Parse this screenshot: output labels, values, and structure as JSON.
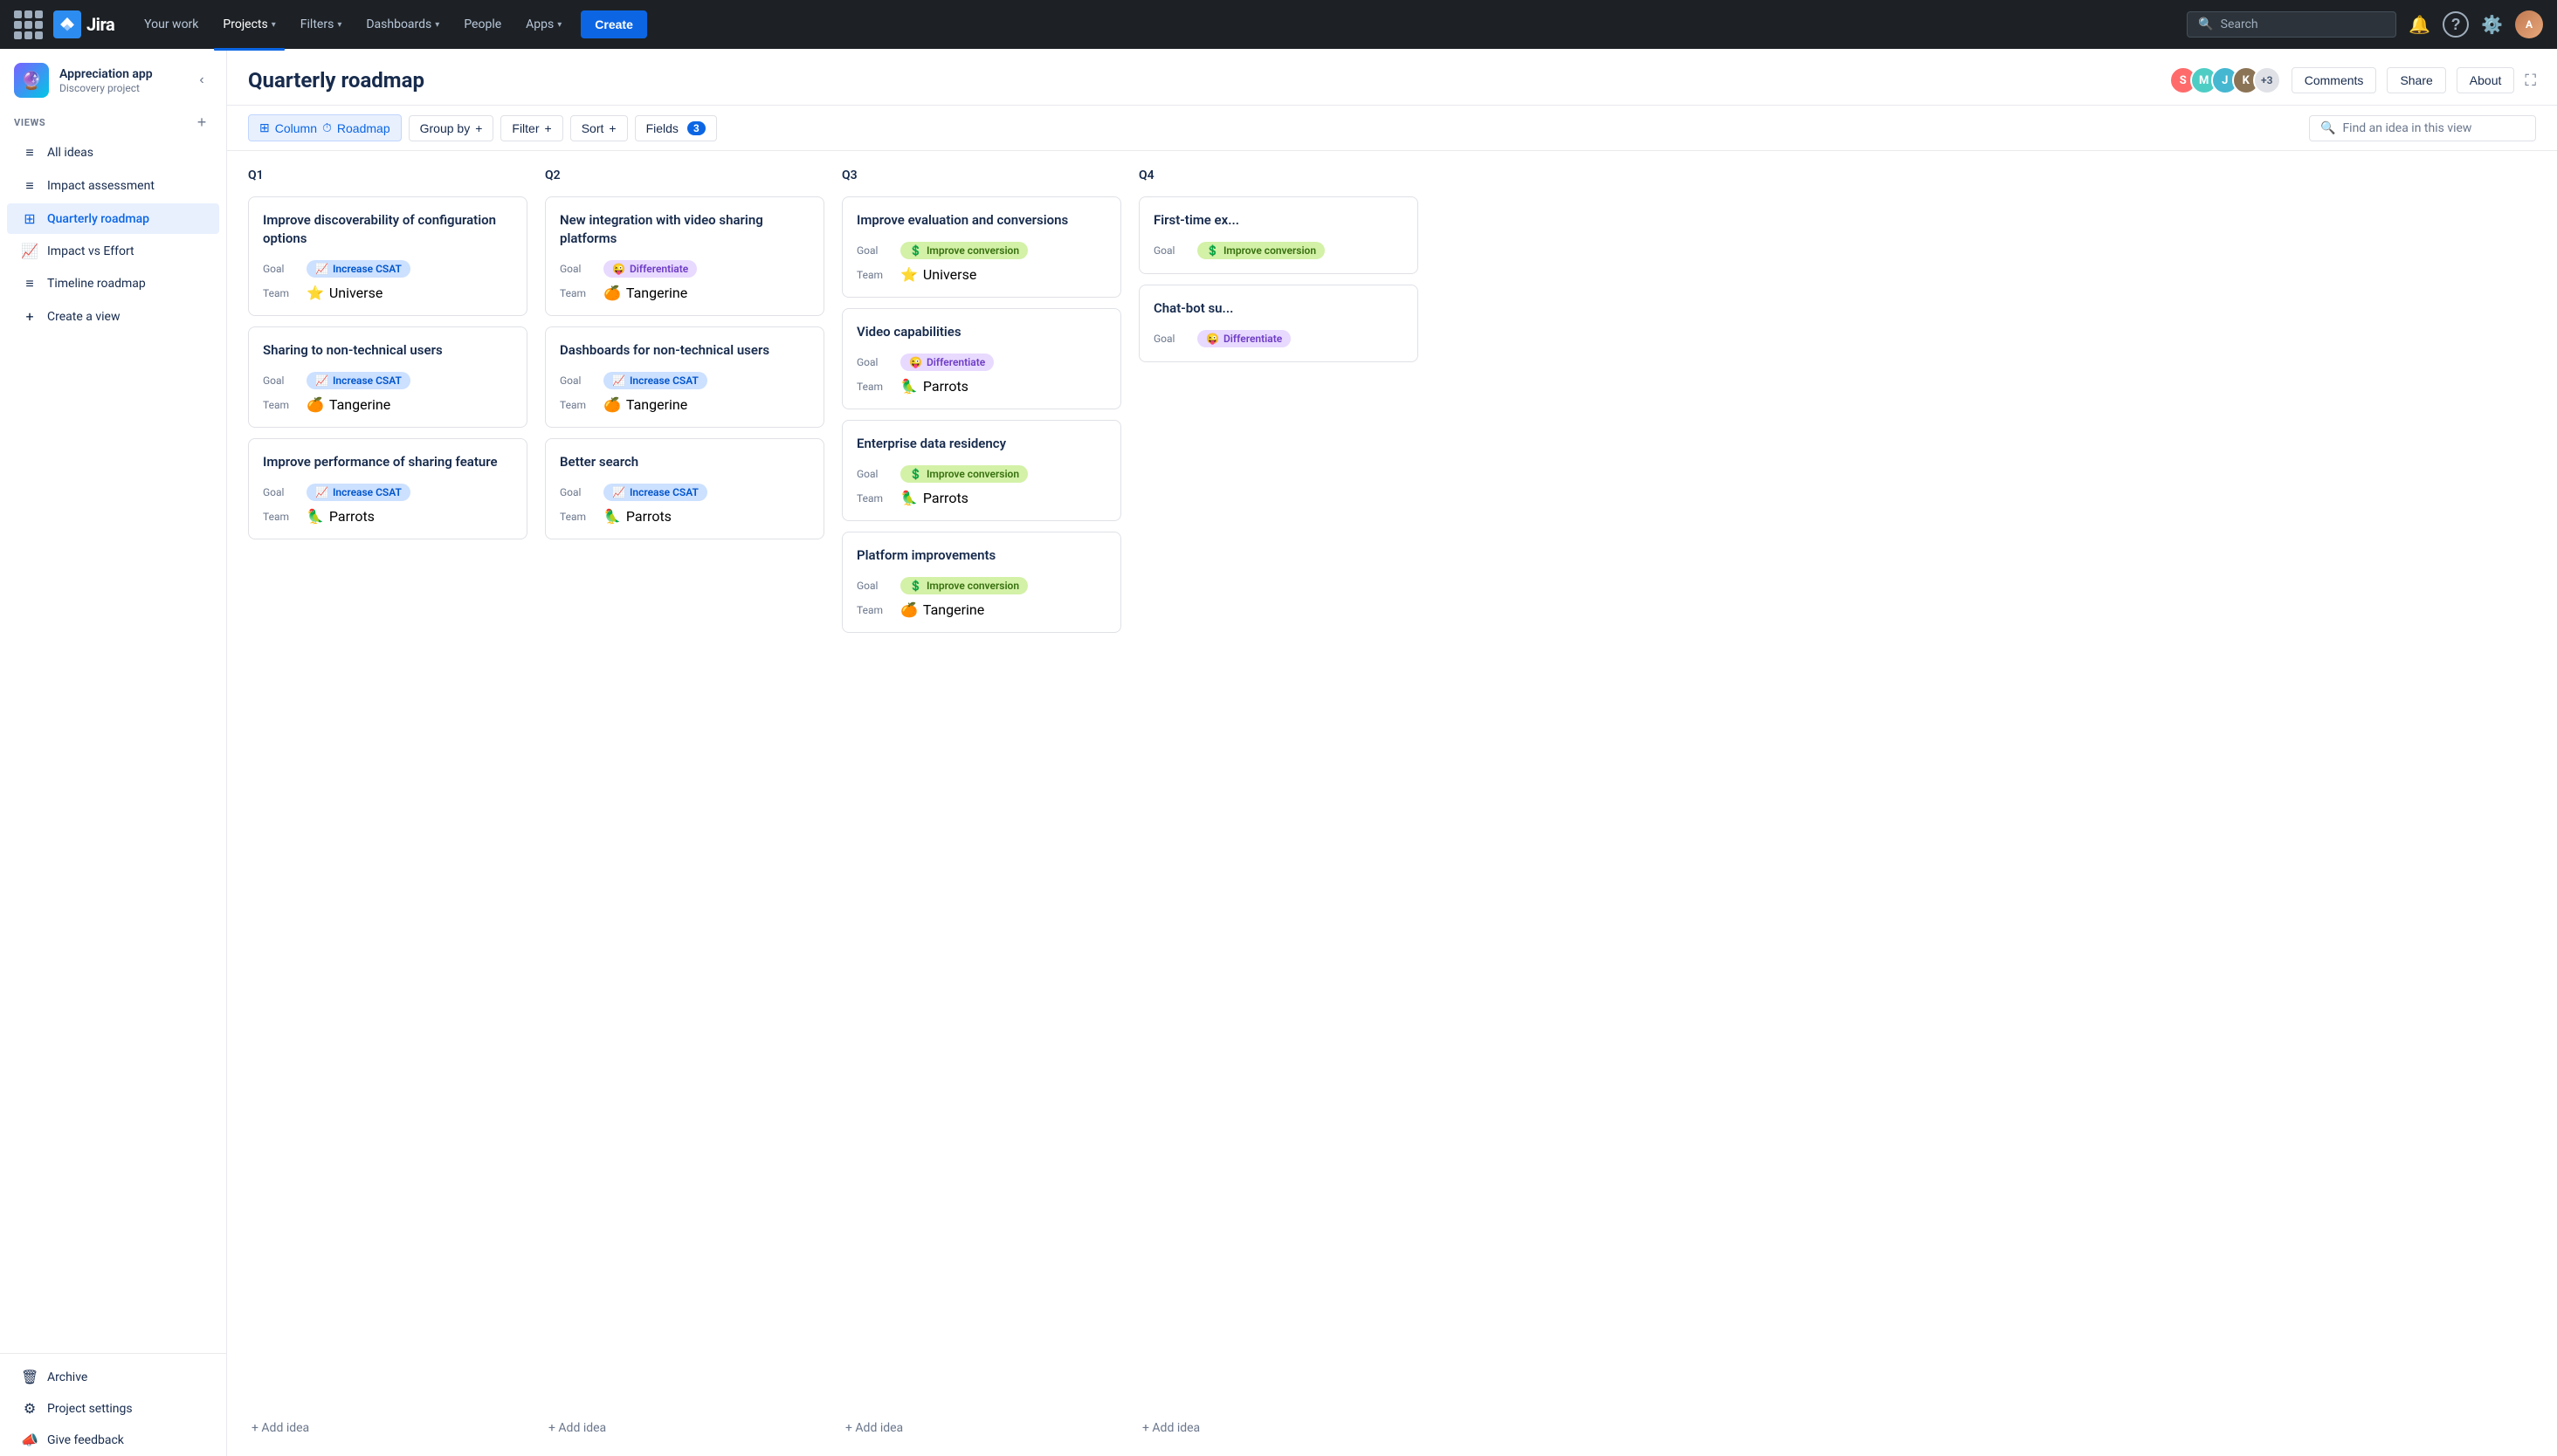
{
  "topnav": {
    "logo_text": "Jira",
    "nav_items": [
      {
        "label": "Your work",
        "active": false
      },
      {
        "label": "Projects",
        "active": true,
        "has_arrow": true
      },
      {
        "label": "Filters",
        "active": false,
        "has_arrow": true
      },
      {
        "label": "Dashboards",
        "active": false,
        "has_arrow": true
      },
      {
        "label": "People",
        "active": false
      },
      {
        "label": "Apps",
        "active": false,
        "has_arrow": true
      }
    ],
    "create_label": "Create",
    "search_placeholder": "Search"
  },
  "sidebar": {
    "project_icon": "🔮",
    "project_name": "Appreciation app",
    "project_type": "Discovery project",
    "views_label": "VIEWS",
    "views": [
      {
        "icon": "≡",
        "label": "All ideas",
        "active": false
      },
      {
        "icon": "≡",
        "label": "Impact assessment",
        "active": false
      },
      {
        "icon": "⊞",
        "label": "Quarterly roadmap",
        "active": true
      },
      {
        "icon": "📈",
        "label": "Impact vs Effort",
        "active": false
      },
      {
        "icon": "≡",
        "label": "Timeline roadmap",
        "active": false
      },
      {
        "icon": "+",
        "label": "Create a view",
        "active": false
      }
    ],
    "bottom_items": [
      {
        "icon": "🗑",
        "label": "Archive"
      },
      {
        "icon": "⚙",
        "label": "Project settings"
      },
      {
        "icon": "📣",
        "label": "Give feedback"
      }
    ]
  },
  "page": {
    "title": "Quarterly roadmap",
    "header_buttons": {
      "comments": "Comments",
      "share": "Share",
      "about": "About"
    },
    "avatars": [
      "+3"
    ]
  },
  "toolbar": {
    "column_label": "Column",
    "column_type": "Roadmap",
    "group_by_label": "Group by",
    "filter_label": "Filter",
    "sort_label": "Sort",
    "fields_label": "Fields",
    "fields_count": "3",
    "search_placeholder": "Find an idea in this view"
  },
  "board": {
    "columns": [
      {
        "id": "q1",
        "header": "Q1",
        "cards": [
          {
            "title": "Improve discoverability of configuration options",
            "goal_emoji": "📈",
            "goal_label": "Increase CSAT",
            "goal_tag_class": "tag-blue",
            "team_emoji": "⭐",
            "team_label": "Universe"
          },
          {
            "title": "Sharing to non-technical users",
            "goal_emoji": "📈",
            "goal_label": "Increase CSAT",
            "goal_tag_class": "tag-blue",
            "team_emoji": "🍊",
            "team_label": "Tangerine"
          },
          {
            "title": "Improve performance of sharing feature",
            "goal_emoji": "📈",
            "goal_label": "Increase CSAT",
            "goal_tag_class": "tag-blue",
            "team_emoji": "🦜",
            "team_label": "Parrots"
          }
        ],
        "add_label": "+ Add idea"
      },
      {
        "id": "q2",
        "header": "Q2",
        "cards": [
          {
            "title": "New integration with video sharing platforms",
            "goal_emoji": "😜",
            "goal_label": "Differentiate",
            "goal_tag_class": "tag-purple",
            "team_emoji": "🍊",
            "team_label": "Tangerine"
          },
          {
            "title": "Dashboards for non-technical users",
            "goal_emoji": "📈",
            "goal_label": "Increase CSAT",
            "goal_tag_class": "tag-blue",
            "team_emoji": "🍊",
            "team_label": "Tangerine"
          },
          {
            "title": "Better search",
            "goal_emoji": "📈",
            "goal_label": "Increase CSAT",
            "goal_tag_class": "tag-blue",
            "team_emoji": "🦜",
            "team_label": "Parrots"
          }
        ],
        "add_label": "+ Add idea"
      },
      {
        "id": "q3",
        "header": "Q3",
        "cards": [
          {
            "title": "Improve evaluation and conversions",
            "goal_emoji": "💲",
            "goal_label": "Improve conversion",
            "goal_tag_class": "tag-green",
            "team_emoji": "⭐",
            "team_label": "Universe"
          },
          {
            "title": "Video capabilities",
            "goal_emoji": "😜",
            "goal_label": "Differentiate",
            "goal_tag_class": "tag-purple",
            "team_emoji": "🦜",
            "team_label": "Parrots"
          },
          {
            "title": "Enterprise data residency",
            "goal_emoji": "💲",
            "goal_label": "Improve conversion",
            "goal_tag_class": "tag-green",
            "team_emoji": "🦜",
            "team_label": "Parrots"
          },
          {
            "title": "Platform improvements",
            "goal_emoji": "💲",
            "goal_label": "Improve conversion",
            "goal_tag_class": "tag-green",
            "team_emoji": "🍊",
            "team_label": "Tangerine"
          }
        ],
        "add_label": "+ Add idea"
      },
      {
        "id": "q4",
        "header": "Q4",
        "cards": [
          {
            "title": "First-time ex...",
            "goal_emoji": "💲",
            "goal_label": "Improve conversion",
            "goal_tag_class": "tag-green",
            "team_emoji": "",
            "team_label": ""
          },
          {
            "title": "Chat-bot su...",
            "goal_emoji": "😜",
            "goal_label": "Differentiate",
            "goal_tag_class": "tag-purple",
            "team_emoji": "",
            "team_label": ""
          }
        ],
        "add_label": "+ Add idea"
      }
    ]
  }
}
